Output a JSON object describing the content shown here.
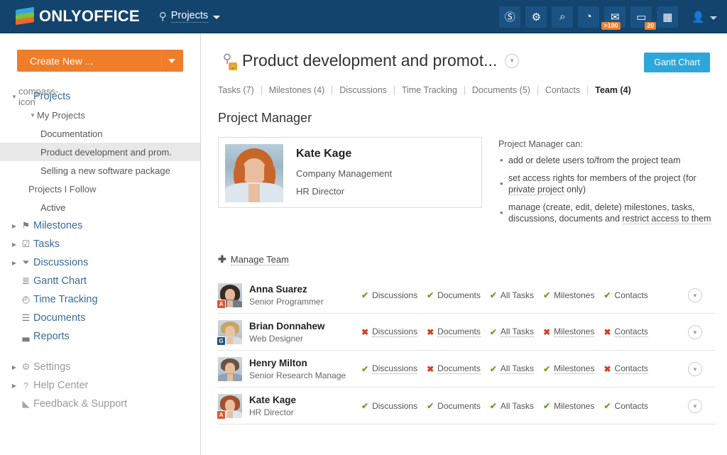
{
  "header": {
    "logo_text": "ONLYOFFICE",
    "module_name": "Projects",
    "module_icon": "compass-icon",
    "icons": [
      {
        "name": "payments-icon",
        "glyph": "Ⓢ",
        "badge": null
      },
      {
        "name": "settings-gear-icon",
        "glyph": "⚙",
        "badge": null
      },
      {
        "name": "search-icon",
        "glyph": "⌕",
        "badge": null
      },
      {
        "name": "gauge-icon",
        "glyph": "◔",
        "badge": null
      },
      {
        "name": "mail-icon",
        "glyph": "✉",
        "badge": ">100"
      },
      {
        "name": "chat-icon",
        "glyph": "▭",
        "badge": "20"
      },
      {
        "name": "calendar-icon",
        "glyph": "▦",
        "badge": null
      }
    ],
    "user_menu": "profile-menu"
  },
  "sidebar": {
    "create_button": "Create New ...",
    "nav": [
      {
        "label": "Projects",
        "level": 1,
        "icon": "compass-icon",
        "arrow": "▼",
        "muted": false
      },
      {
        "label": "My Projects",
        "level": 2,
        "icon": "",
        "arrow": "▼",
        "muted": false
      },
      {
        "label": "Documentation",
        "level": 3,
        "icon": "",
        "arrow": "",
        "muted": false
      },
      {
        "label": "Product development and prom.",
        "level": 3,
        "icon": "",
        "arrow": "",
        "active": true
      },
      {
        "label": "Selling a new software package",
        "level": 3,
        "icon": "",
        "arrow": "",
        "muted": false
      },
      {
        "label": "Projects I Follow",
        "level": 2,
        "icon": "",
        "arrow": "",
        "muted": false
      },
      {
        "label": "Active",
        "level": 3,
        "icon": "",
        "arrow": "",
        "muted": false
      },
      {
        "label": "Milestones",
        "level": 1,
        "icon": "⚑",
        "arrow": "▶",
        "muted": false
      },
      {
        "label": "Tasks",
        "level": 1,
        "icon": "☑",
        "arrow": "▶",
        "muted": false
      },
      {
        "label": "Discussions",
        "level": 1,
        "icon": "⏷",
        "arrow": "▶",
        "muted": false
      },
      {
        "label": "Gantt Chart",
        "level": 1,
        "icon": "≣",
        "arrow": "",
        "muted": false
      },
      {
        "label": "Time Tracking",
        "level": 1,
        "icon": "◴",
        "arrow": "",
        "muted": false
      },
      {
        "label": "Documents",
        "level": 1,
        "icon": "☰",
        "arrow": "",
        "muted": false
      },
      {
        "label": "Reports",
        "level": 1,
        "icon": "▃",
        "arrow": "",
        "muted": false
      },
      {
        "label": "Settings",
        "level": 1,
        "icon": "⚙",
        "arrow": "▶",
        "muted": true
      },
      {
        "label": "Help Center",
        "level": 1,
        "icon": "?",
        "arrow": "▶",
        "muted": true
      },
      {
        "label": "Feedback & Support",
        "level": 1,
        "icon": "◣",
        "arrow": "",
        "muted": true
      }
    ]
  },
  "page": {
    "title": "Product development and promot...",
    "title_icon": "compass-icon",
    "lock_icon": "lock-icon",
    "title_dropdown_icon": "chevron-down-icon",
    "gantt_button": "Gantt Chart",
    "tabs": [
      {
        "label": "Tasks (7)",
        "active": false
      },
      {
        "label": "Milestones (4)",
        "active": false
      },
      {
        "label": "Discussions",
        "active": false
      },
      {
        "label": "Time Tracking",
        "active": false
      },
      {
        "label": "Documents (5)",
        "active": false
      },
      {
        "label": "Contacts",
        "active": false
      },
      {
        "label": "Team (4)",
        "active": true
      }
    ]
  },
  "project_manager": {
    "section_title": "Project Manager",
    "name": "Kate Kage",
    "department": "Company Management",
    "role": "HR Director",
    "can_title": "Project Manager can:",
    "can_items": [
      {
        "text": "add or delete users to/from the project team",
        "link": null,
        "tail": null
      },
      {
        "text": "set access rights for members of the project (for ",
        "link": "private project",
        "tail": " only)"
      },
      {
        "text": "manage (create, edit, delete) milestones, tasks, discussions, documents and ",
        "link": "restrict access to them",
        "tail": ""
      }
    ]
  },
  "team": {
    "manage_label": "Manage Team",
    "manage_icon": "plus-icon",
    "row_menu_icon": "chevron-down-icon",
    "members": [
      {
        "name": "Anna Suarez",
        "role": "Senior Programmer",
        "badge": "A",
        "badge_kind": "admin",
        "underlined": false,
        "permissions": [
          {
            "label": "Discussions",
            "allowed": true
          },
          {
            "label": "Documents",
            "allowed": true
          },
          {
            "label": "All Tasks",
            "allowed": true
          },
          {
            "label": "Milestones",
            "allowed": true
          },
          {
            "label": "Contacts",
            "allowed": true
          }
        ]
      },
      {
        "name": "Brian Donnahew",
        "role": "Web Designer",
        "badge": "G",
        "badge_kind": "guest",
        "underlined": true,
        "permissions": [
          {
            "label": "Discussions",
            "allowed": false
          },
          {
            "label": "Documents",
            "allowed": false
          },
          {
            "label": "All Tasks",
            "allowed": true
          },
          {
            "label": "Milestones",
            "allowed": false
          },
          {
            "label": "Contacts",
            "allowed": false
          }
        ]
      },
      {
        "name": "Henry Milton",
        "role": "Senior Research Manage",
        "badge": null,
        "badge_kind": null,
        "underlined": true,
        "permissions": [
          {
            "label": "Discussions",
            "allowed": true
          },
          {
            "label": "Documents",
            "allowed": false
          },
          {
            "label": "All Tasks",
            "allowed": true
          },
          {
            "label": "Milestones",
            "allowed": true
          },
          {
            "label": "Contacts",
            "allowed": false
          }
        ]
      },
      {
        "name": "Kate Kage",
        "role": "HR Director",
        "badge": "A",
        "badge_kind": "admin",
        "underlined": false,
        "permissions": [
          {
            "label": "Discussions",
            "allowed": true
          },
          {
            "label": "Documents",
            "allowed": true
          },
          {
            "label": "All Tasks",
            "allowed": true
          },
          {
            "label": "Milestones",
            "allowed": true
          },
          {
            "label": "Contacts",
            "allowed": true
          }
        ]
      }
    ],
    "marks": {
      "yes": "✔",
      "no": "✖"
    }
  },
  "colors": {
    "header_bg": "#12446E",
    "accent_orange": "#F07D29",
    "accent_blue": "#2DA7DB",
    "allow_green": "#6AA528",
    "deny_red": "#D23D22"
  }
}
